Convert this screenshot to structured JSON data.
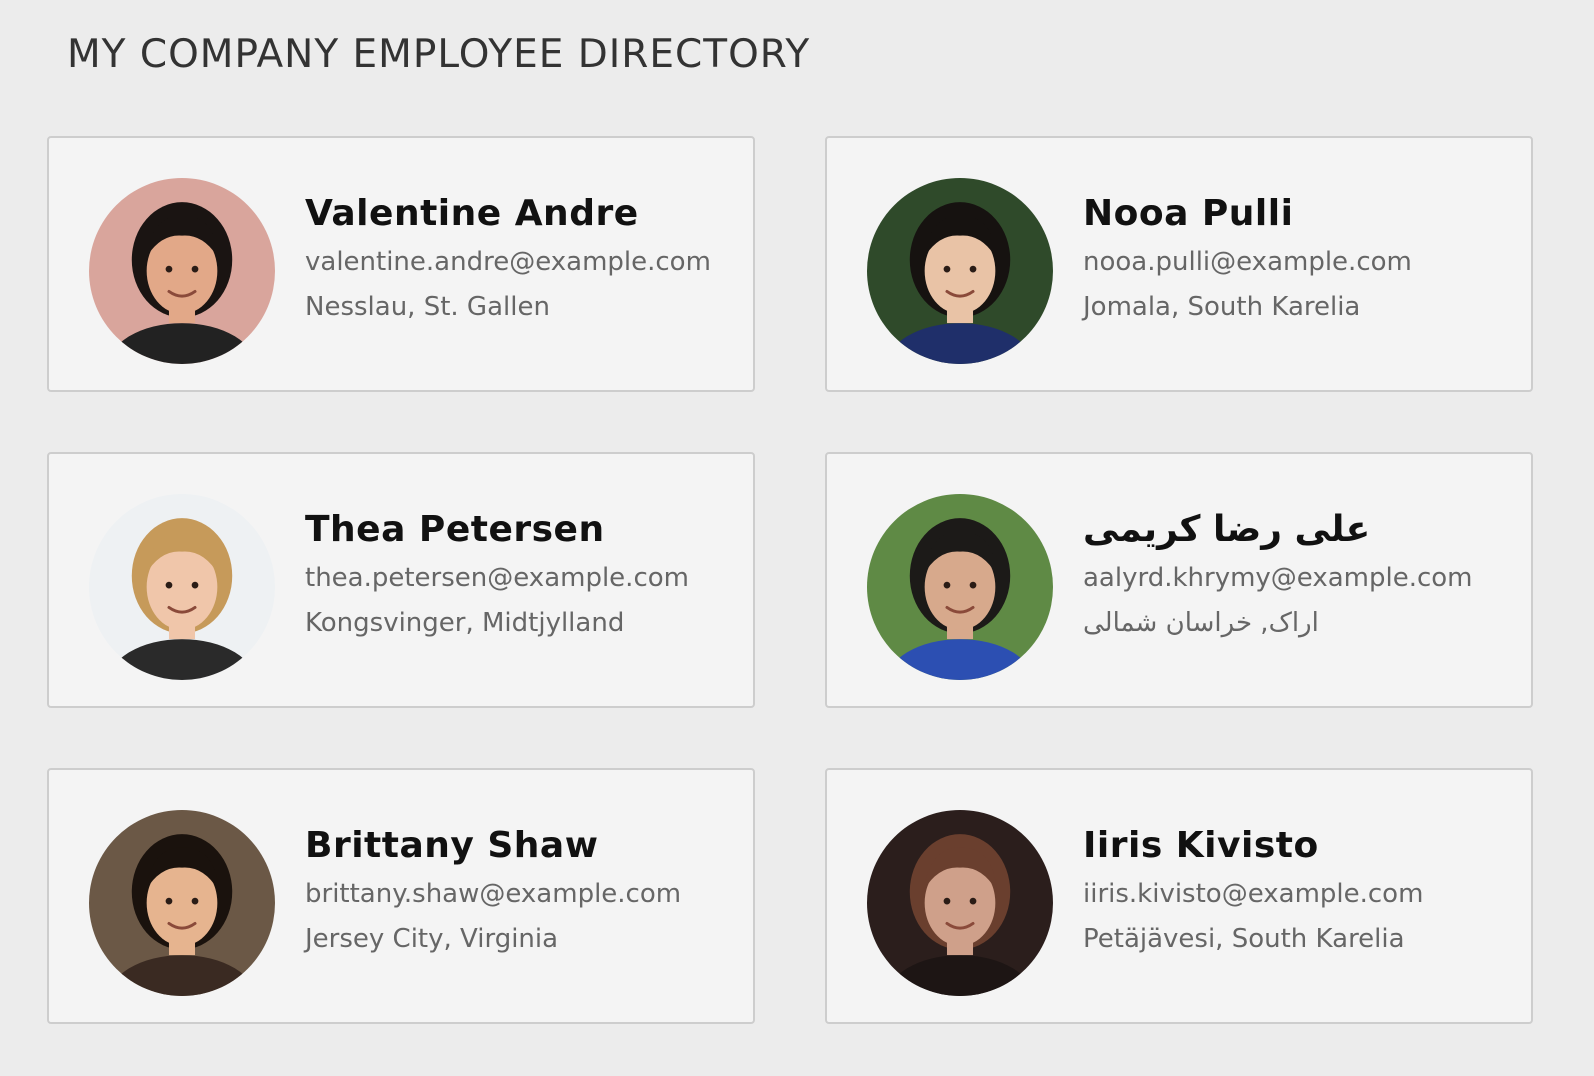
{
  "header": {
    "title": "MY COMPANY EMPLOYEE DIRECTORY"
  },
  "employees": [
    {
      "name": "Valentine Andre",
      "email": "valentine.andre@example.com",
      "location": "Nesslau, St. Gallen",
      "avatar_icon": "photo-valentine-andre",
      "colors": {
        "bg": "#d9a59c",
        "skin": "#e2a888",
        "hair": "#1a1412",
        "shirt": "#222222"
      }
    },
    {
      "name": "Nooa Pulli",
      "email": "nooa.pulli@example.com",
      "location": "Jomala, South Karelia",
      "avatar_icon": "photo-nooa-pulli",
      "colors": {
        "bg": "#2f4a2a",
        "skin": "#e9c3a6",
        "hair": "#161210",
        "shirt": "#1f2f6a"
      }
    },
    {
      "name": "Thea Petersen",
      "email": "thea.petersen@example.com",
      "location": "Kongsvinger, Midtjylland",
      "avatar_icon": "photo-thea-petersen",
      "colors": {
        "bg": "#eef1f3",
        "skin": "#f0c6aa",
        "hair": "#c69a5a",
        "shirt": "#2a2a2a"
      }
    },
    {
      "name": "علی رضا کریمی",
      "email": "aalyrd.khrymy@example.com",
      "location": "اراک, خراسان شمالی",
      "avatar_icon": "photo-ali-reza-karimi",
      "colors": {
        "bg": "#5f8a45",
        "skin": "#d7a98c",
        "hair": "#1c1a18",
        "shirt": "#2c4fb2"
      }
    },
    {
      "name": "Brittany Shaw",
      "email": "brittany.shaw@example.com",
      "location": "Jersey City, Virginia",
      "avatar_icon": "photo-brittany-shaw",
      "colors": {
        "bg": "#6b5846",
        "skin": "#e6b48f",
        "hair": "#1a120d",
        "shirt": "#3a2a22"
      }
    },
    {
      "name": "Iiris Kivisto",
      "email": "iiris.kivisto@example.com",
      "location": "Petäjävesi, South Karelia",
      "avatar_icon": "photo-iiris-kivisto",
      "colors": {
        "bg": "#2b1e1c",
        "skin": "#cfa08a",
        "hair": "#6a3f2e",
        "shirt": "#1d1514"
      }
    }
  ]
}
